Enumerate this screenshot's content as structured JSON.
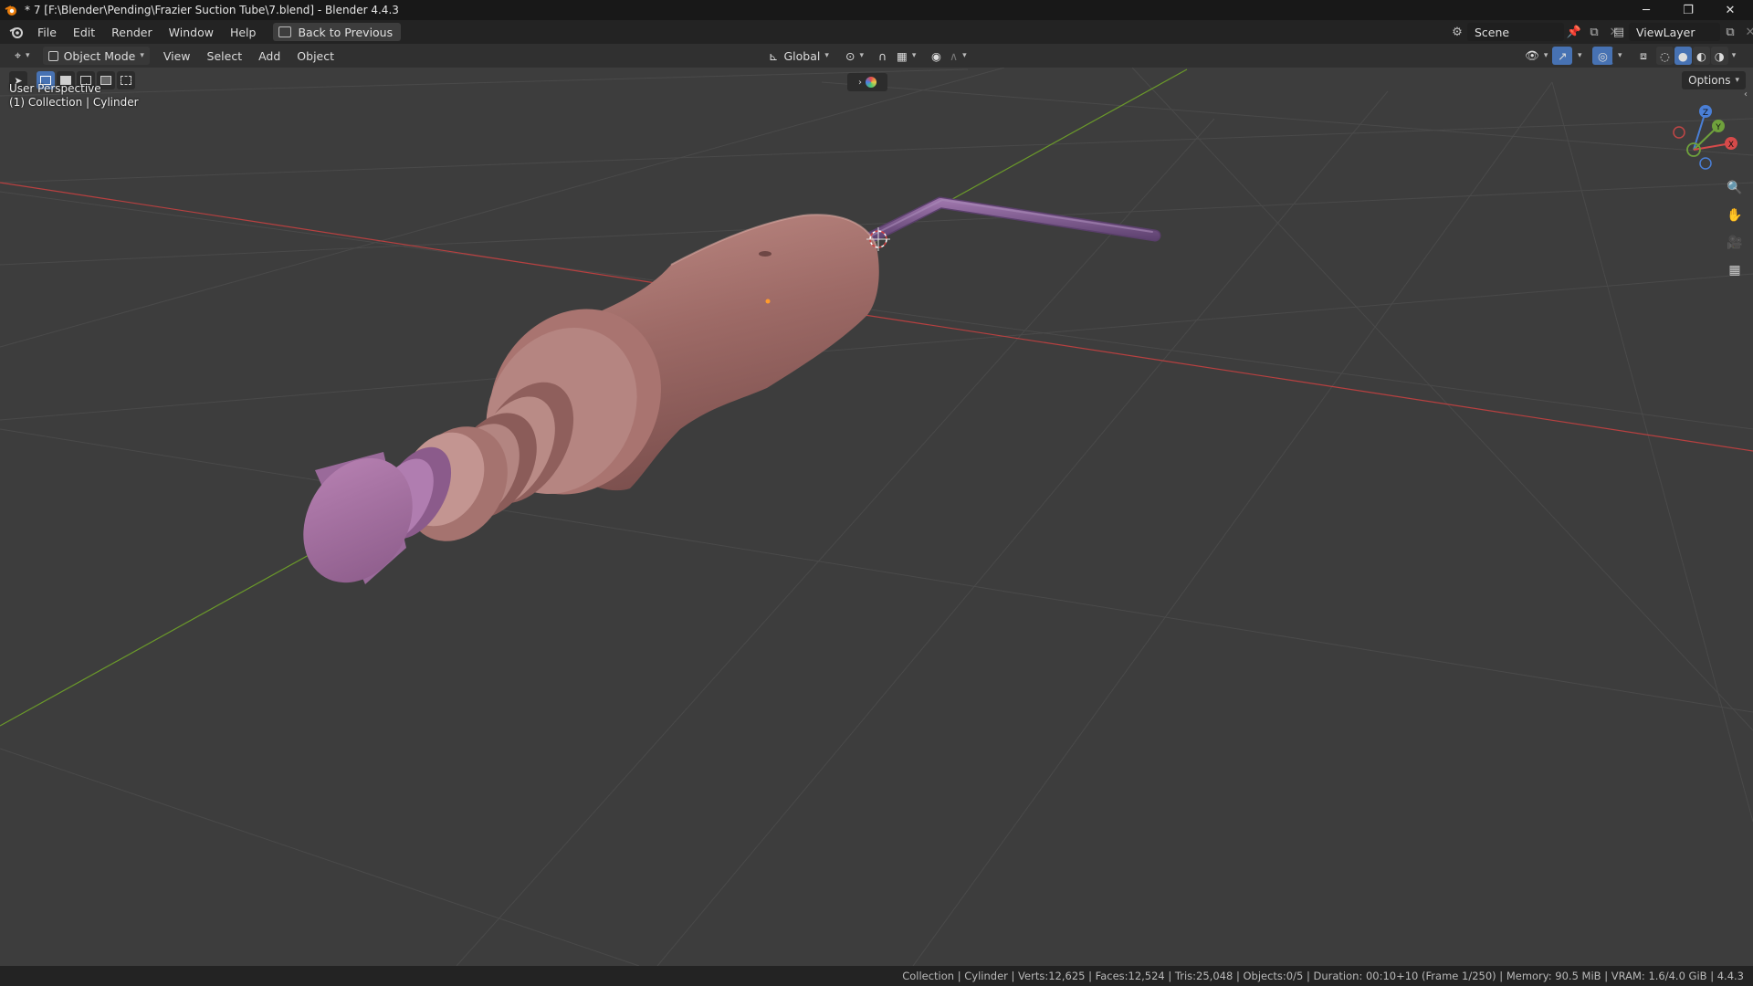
{
  "window": {
    "title": "* 7 [F:\\Blender\\Pending\\Frazier Suction Tube\\7.blend] - Blender 4.4.3",
    "minimize": "─",
    "restore": "❐",
    "close": "✕"
  },
  "menu": {
    "items": [
      "File",
      "Edit",
      "Render",
      "Window",
      "Help"
    ],
    "back_label": "Back to Previous"
  },
  "scene": {
    "name": "Scene",
    "view_layer": "ViewLayer"
  },
  "viewport_header": {
    "mode": "Object Mode",
    "menus": [
      "View",
      "Select",
      "Add",
      "Object"
    ],
    "orientation": "Global",
    "options_label": "Options"
  },
  "viewport": {
    "perspective": "User Perspective",
    "context": "(1) Collection | Cylinder",
    "gizmo": {
      "z": "Z",
      "y": "Y",
      "x": "X"
    }
  },
  "status": {
    "text": "Collection | Cylinder | Verts:12,625 | Faces:12,524 | Tris:25,048 | Objects:0/5 | Duration: 00:10+10 (Frame 1/250) | Memory: 90.5 MiB | VRAM: 1.6/4.0 GiB | 4.4.3"
  },
  "colors": {
    "accent": "#4772b3",
    "axis_x": "#c24545",
    "axis_y": "#6e9a2e",
    "object_body": "#a6706c",
    "object_cap": "#a46aa0",
    "tube": "#7e5a8e"
  }
}
